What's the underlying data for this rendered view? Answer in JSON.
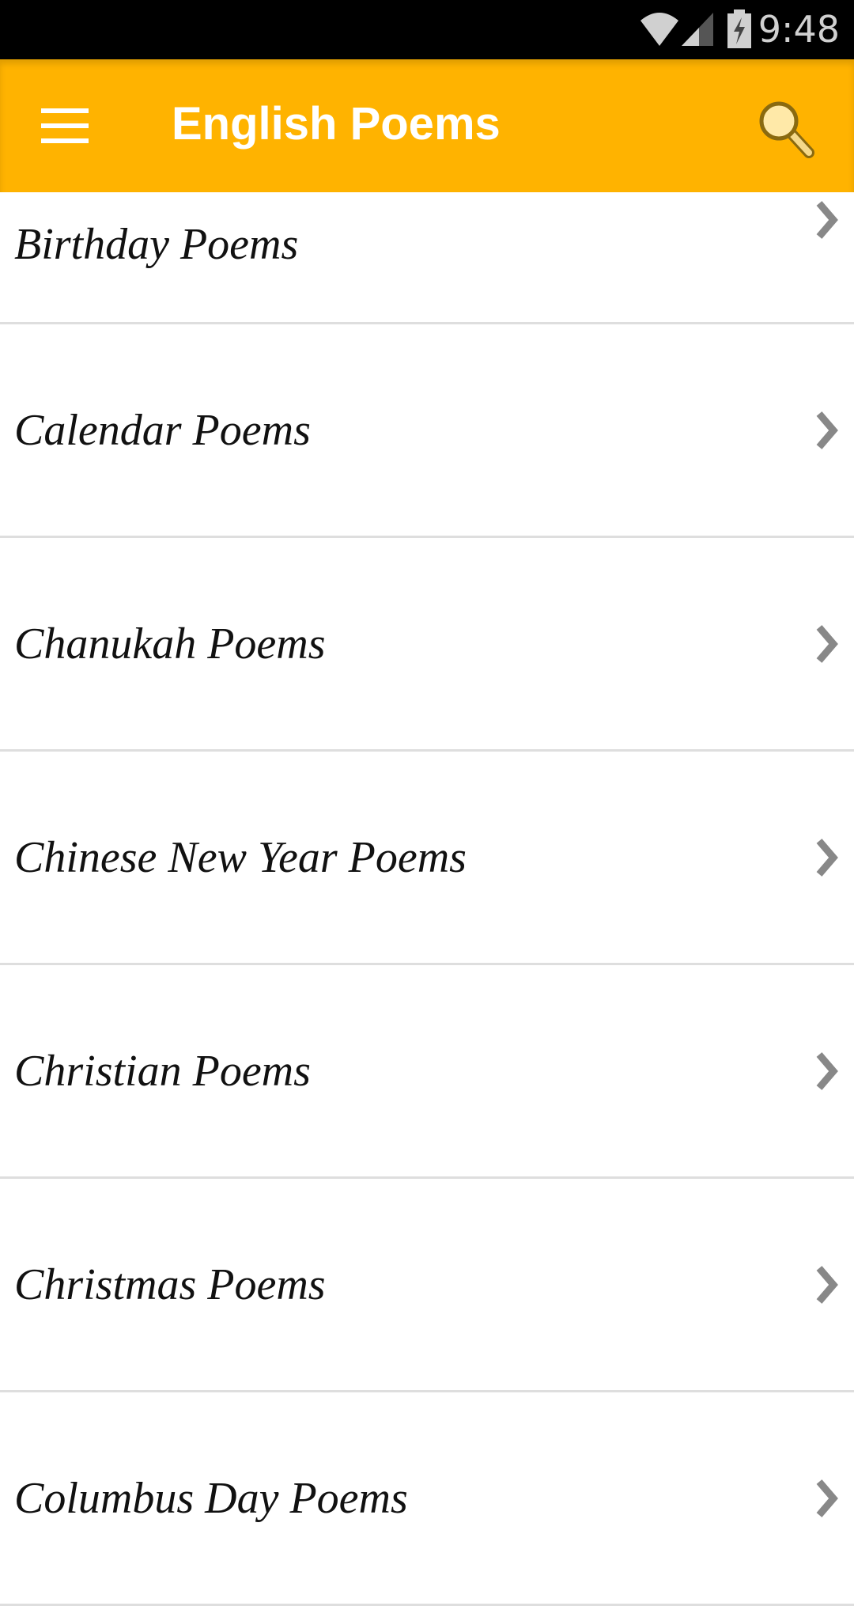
{
  "status_bar": {
    "time": "9:48",
    "icons": [
      "wifi-icon",
      "signal-icon",
      "battery-charging-icon"
    ]
  },
  "app_bar": {
    "title": "English Poems",
    "menu_icon": "hamburger-menu-icon",
    "search_icon": "search-icon",
    "color": "#FFB300"
  },
  "list": {
    "items": [
      {
        "label": "Birthday Poems"
      },
      {
        "label": "Calendar Poems"
      },
      {
        "label": "Chanukah Poems"
      },
      {
        "label": "Chinese New Year Poems"
      },
      {
        "label": "Christian Poems"
      },
      {
        "label": "Christmas Poems"
      },
      {
        "label": "Columbus Day Poems"
      }
    ]
  }
}
